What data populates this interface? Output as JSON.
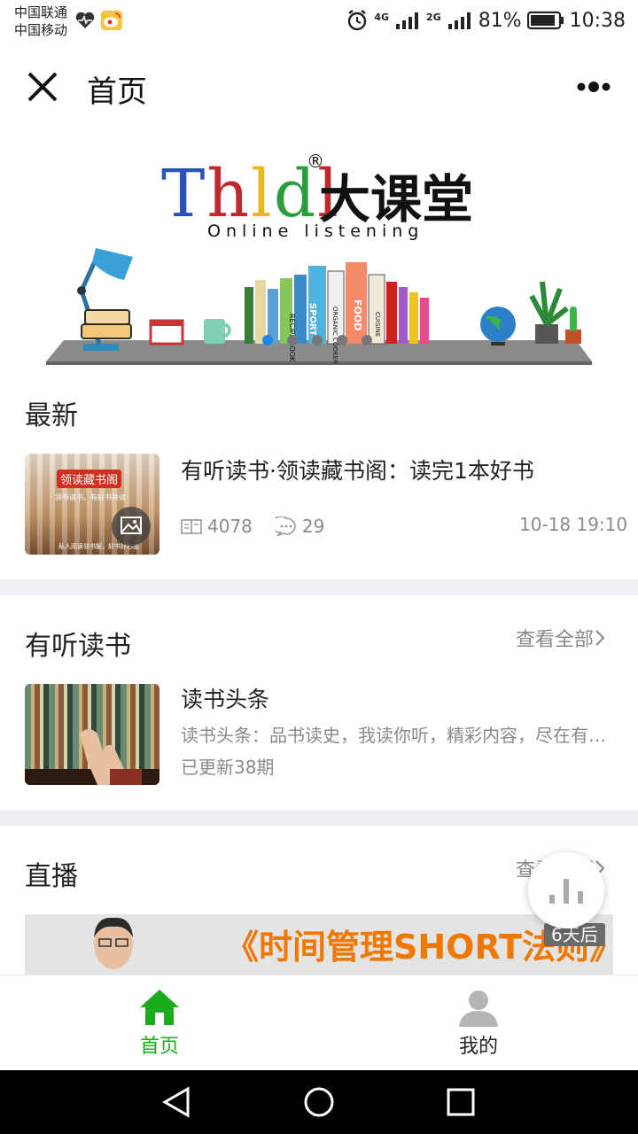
{
  "status": {
    "carrier1": "中国联通",
    "carrier2": "中国移动",
    "net1": "4G",
    "net2": "2G",
    "battery": "81%",
    "time": "10:38"
  },
  "nav": {
    "title": "首页"
  },
  "banner": {
    "logo_latin": "Thldl",
    "logo_registered": "®",
    "logo_cn": "大课堂",
    "tagline": "Online listening",
    "book_spines": [
      "RECIPE BOOK",
      "SPORT",
      "ORGANIC COOKER",
      "FOOD",
      "CUISINE"
    ],
    "slide_count": 5,
    "active_slide": 1
  },
  "latest": {
    "heading": "最新",
    "item": {
      "thumb_title": "领读藏书阁",
      "thumb_sub": "领书读书，有好书共读",
      "thumb_foot": "私人阅读领书服，好书好心态",
      "title": "有听读书·领读藏书阁：读完1本好书",
      "reads": "4078",
      "comments": "29",
      "date": "10-18 19:10"
    }
  },
  "audio_books": {
    "heading": "有听读书",
    "see_all": "查看全部",
    "item": {
      "title": "读书头条",
      "desc": "读书头条：品书读史，我读你听，精彩内容，尽在有…",
      "updated": "已更新38期"
    }
  },
  "live": {
    "heading": "直播",
    "see_all": "查看全部",
    "banner_text": "《时间管理SHORT法则》",
    "badge": "6天后"
  },
  "tabs": [
    {
      "label": "首页",
      "active": true
    },
    {
      "label": "我的",
      "active": false
    }
  ],
  "colors": {
    "accent": "#1aad19",
    "divider": "#efeff3",
    "live_text": "#f07800"
  }
}
